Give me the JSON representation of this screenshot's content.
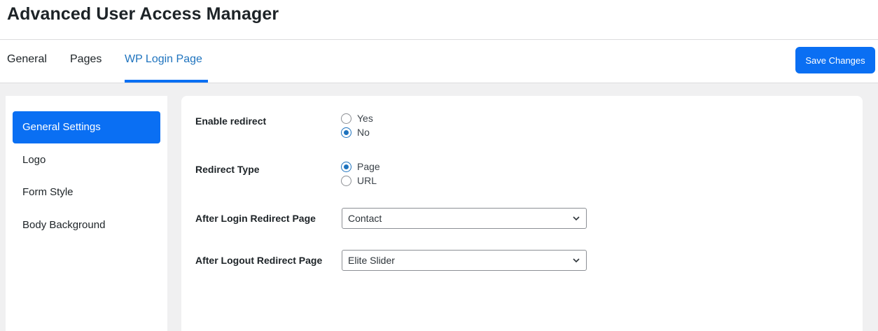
{
  "header": {
    "title": "Advanced User Access Manager"
  },
  "tabs": [
    {
      "label": "General"
    },
    {
      "label": "Pages"
    },
    {
      "label": "WP Login Page"
    }
  ],
  "toolbar": {
    "save_label": "Save Changes"
  },
  "sidebar": {
    "items": [
      {
        "label": "General Settings"
      },
      {
        "label": "Logo"
      },
      {
        "label": "Form Style"
      },
      {
        "label": "Body Background"
      }
    ]
  },
  "settings": {
    "enable_redirect": {
      "label": "Enable redirect",
      "options": [
        "Yes",
        "No"
      ],
      "selected": "No"
    },
    "redirect_type": {
      "label": "Redirect Type",
      "options": [
        "Page",
        "URL"
      ],
      "selected": "Page"
    },
    "after_login": {
      "label": "After Login Redirect Page",
      "value": "Contact"
    },
    "after_logout": {
      "label": "After Logout Redirect Page",
      "value": "Elite Slider"
    }
  },
  "colors": {
    "accent": "#0a6ff3",
    "active_tab": "#1e73be",
    "background": "#f0f0f1"
  }
}
